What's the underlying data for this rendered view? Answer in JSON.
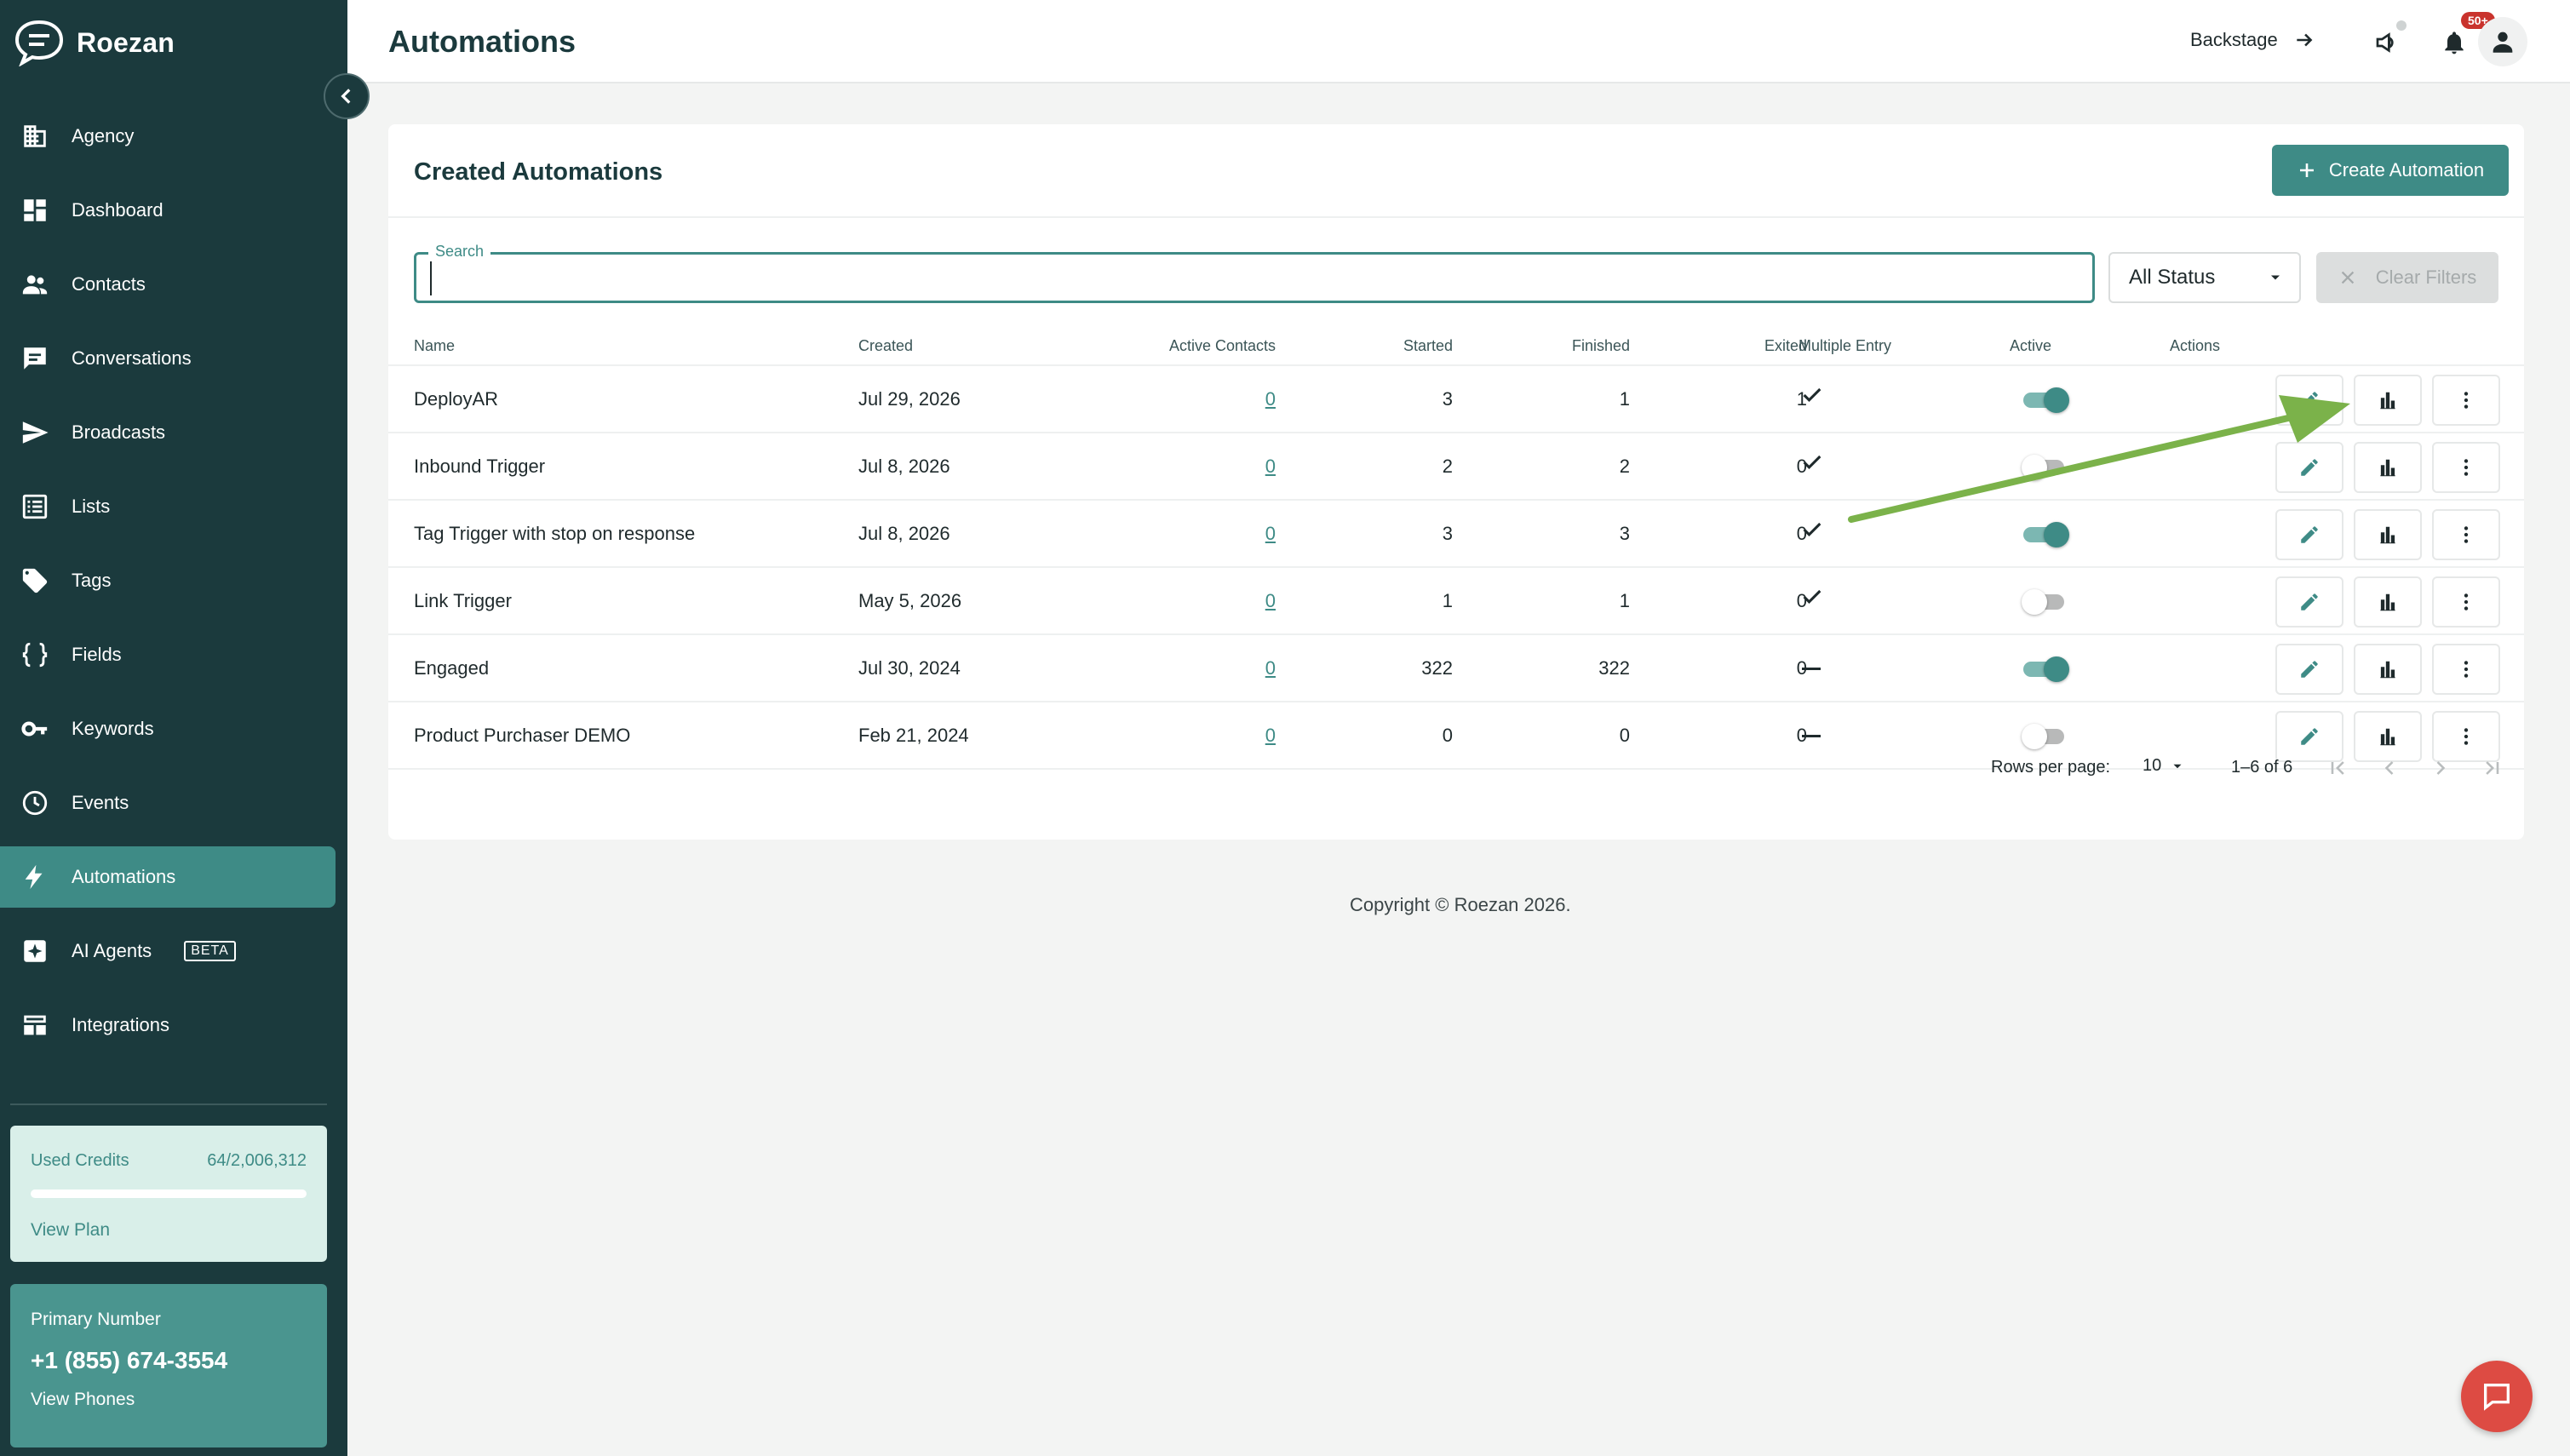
{
  "app": {
    "name": "Roezan"
  },
  "sidebar": {
    "items": [
      {
        "label": "Agency",
        "icon": "building-icon"
      },
      {
        "label": "Dashboard",
        "icon": "dashboard-icon"
      },
      {
        "label": "Contacts",
        "icon": "people-icon"
      },
      {
        "label": "Conversations",
        "icon": "chat-icon"
      },
      {
        "label": "Broadcasts",
        "icon": "send-icon"
      },
      {
        "label": "Lists",
        "icon": "list-icon"
      },
      {
        "label": "Tags",
        "icon": "tag-icon"
      },
      {
        "label": "Fields",
        "icon": "braces-icon"
      },
      {
        "label": "Keywords",
        "icon": "key-icon"
      },
      {
        "label": "Events",
        "icon": "clock-icon"
      },
      {
        "label": "Automations",
        "icon": "bolt-icon",
        "active": true
      },
      {
        "label": "AI Agents",
        "icon": "ai-spark-icon",
        "badge": "BETA"
      },
      {
        "label": "Integrations",
        "icon": "grid-icon"
      }
    ],
    "credits": {
      "label": "Used Credits",
      "value": "64/2,006,312",
      "used_fraction": 3e-05,
      "link": "View Plan"
    },
    "phone": {
      "label": "Primary Number",
      "number": "+1 (855) 674-3554",
      "link": "View Phones"
    }
  },
  "header": {
    "title": "Automations",
    "backstage": "Backstage",
    "notification_count": "50+"
  },
  "card": {
    "title": "Created Automations",
    "create_label": "Create Automation",
    "search": {
      "label": "Search",
      "value": "",
      "placeholder": ""
    },
    "status_filter": "All Status",
    "clear_label": "Clear Filters"
  },
  "table": {
    "columns": {
      "name": "Name",
      "created": "Created",
      "active_contacts": "Active Contacts",
      "started": "Started",
      "finished": "Finished",
      "exited": "Exited",
      "multiple_entry": "Multiple Entry",
      "active": "Active",
      "actions": "Actions"
    },
    "rows": [
      {
        "name": "DeployAR",
        "created": "Jul 29, 2026",
        "active_contacts": "0",
        "started": "3",
        "finished": "1",
        "exited": "1",
        "multiple_entry": true,
        "active": true
      },
      {
        "name": "Inbound Trigger",
        "created": "Jul 8, 2026",
        "active_contacts": "0",
        "started": "2",
        "finished": "2",
        "exited": "0",
        "multiple_entry": true,
        "active": false
      },
      {
        "name": "Tag Trigger with stop on response",
        "created": "Jul 8, 2026",
        "active_contacts": "0",
        "started": "3",
        "finished": "3",
        "exited": "0",
        "multiple_entry": true,
        "active": true
      },
      {
        "name": "Link Trigger",
        "created": "May 5, 2026",
        "active_contacts": "0",
        "started": "1",
        "finished": "1",
        "exited": "0",
        "multiple_entry": true,
        "active": false
      },
      {
        "name": "Engaged",
        "created": "Jul 30, 2024",
        "active_contacts": "0",
        "started": "322",
        "finished": "322",
        "exited": "0",
        "multiple_entry": false,
        "active": true
      },
      {
        "name": "Product Purchaser DEMO",
        "created": "Feb 21, 2024",
        "active_contacts": "0",
        "started": "0",
        "finished": "0",
        "exited": "0",
        "multiple_entry": false,
        "active": false
      }
    ]
  },
  "pagination": {
    "rows_per_page_label": "Rows per page:",
    "rows_per_page": "10",
    "range": "1–6 of 6"
  },
  "footer": {
    "copyright": "Copyright © Roezan 2026."
  },
  "colors": {
    "sidebar_bg": "#1b3a3d",
    "accent": "#3e8b86",
    "arrow": "#7bb24a",
    "chat": "#dd4b43",
    "badge": "#c9332d"
  }
}
